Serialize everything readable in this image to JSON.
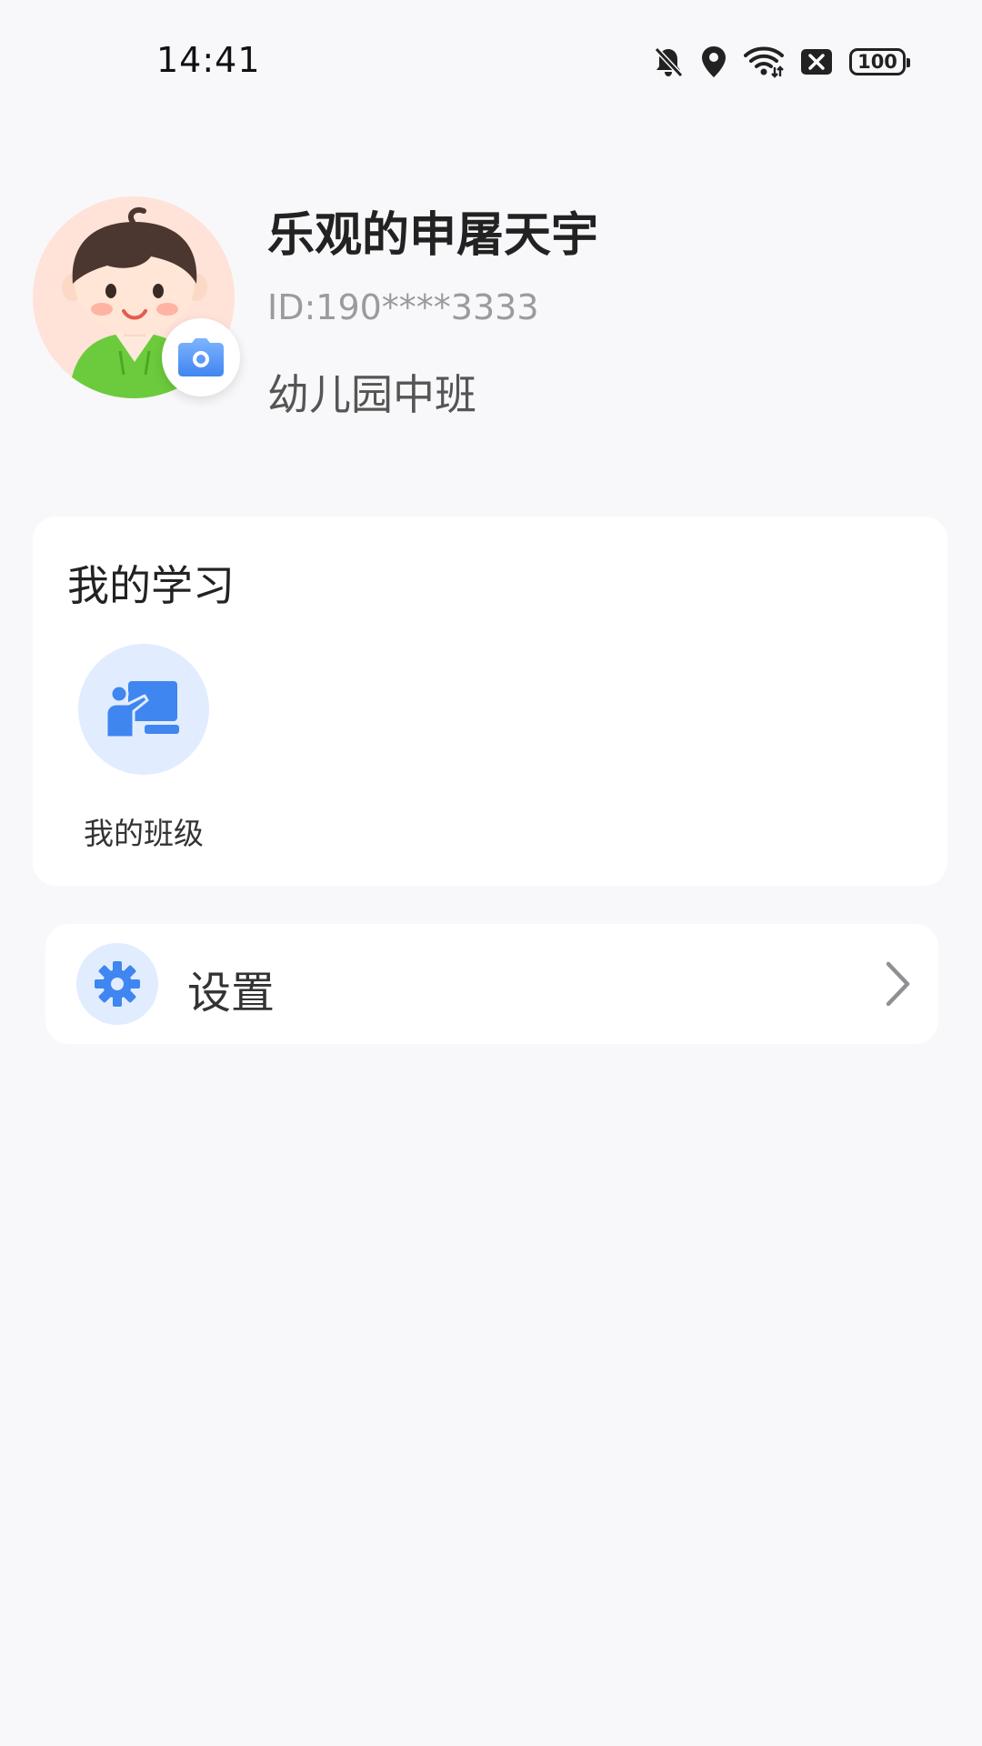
{
  "status_bar": {
    "time": "14:41",
    "battery": "100",
    "icons": [
      "bell-off-icon",
      "location-icon",
      "wifi-icon",
      "close-box-icon",
      "battery-icon"
    ]
  },
  "profile": {
    "name": "乐观的申屠天宇",
    "id": "ID:190****3333",
    "grade": "幼儿园中班",
    "avatar_icon": "child-avatar",
    "camera_icon": "camera-icon"
  },
  "learning": {
    "title": "我的学习",
    "items": [
      {
        "label": "我的班级",
        "icon": "classroom-icon"
      }
    ]
  },
  "settings": {
    "label": "设置",
    "icon": "gear-icon"
  },
  "colors": {
    "background": "#f8f8fa",
    "card": "#ffffff",
    "accent_blue": "#3f86f0",
    "icon_circle": "#e2ecff",
    "avatar_bg": "#ffe3d8"
  }
}
